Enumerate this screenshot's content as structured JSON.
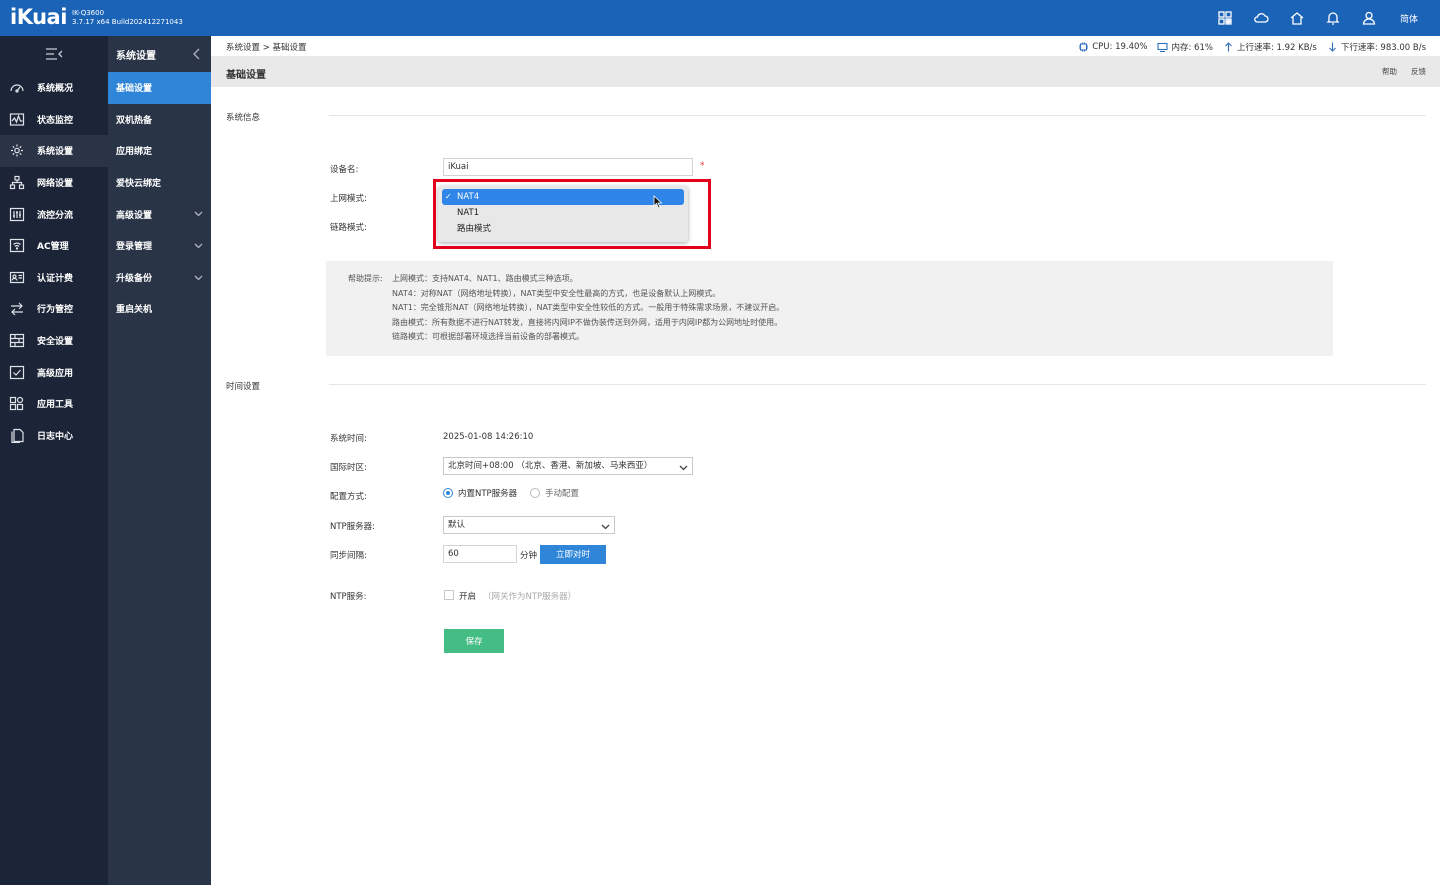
{
  "topbar": {
    "logo": "iKuai",
    "model": "IK-Q3600",
    "version": "3.7.17 x64 Build202412271043",
    "icons": [
      "grid-icon",
      "cloud-icon",
      "home-icon",
      "bell-icon",
      "user-icon"
    ],
    "lang": "简体"
  },
  "sidebar": {
    "items": [
      {
        "label": "系统概况",
        "icon": "dashboard-icon"
      },
      {
        "label": "状态监控",
        "icon": "monitor-icon"
      },
      {
        "label": "系统设置",
        "icon": "gear-icon",
        "active": true
      },
      {
        "label": "网络设置",
        "icon": "network-icon"
      },
      {
        "label": "流控分流",
        "icon": "sliders-icon"
      },
      {
        "label": "AC管理",
        "icon": "wifi-icon"
      },
      {
        "label": "认证计费",
        "icon": "id-card-icon"
      },
      {
        "label": "行为管控",
        "icon": "arrows-icon"
      },
      {
        "label": "安全设置",
        "icon": "firewall-icon"
      },
      {
        "label": "高级应用",
        "icon": "check-icon"
      },
      {
        "label": "应用工具",
        "icon": "apps-icon"
      },
      {
        "label": "日志中心",
        "icon": "log-icon"
      }
    ]
  },
  "subnav": {
    "title": "系统设置",
    "items": [
      {
        "label": "基础设置",
        "active": true
      },
      {
        "label": "双机热备"
      },
      {
        "label": "应用绑定"
      },
      {
        "label": "爱快云绑定"
      },
      {
        "label": "高级设置",
        "expand": true
      },
      {
        "label": "登录管理",
        "expand": true
      },
      {
        "label": "升级备份",
        "expand": true
      },
      {
        "label": "重启关机"
      }
    ]
  },
  "header": {
    "breadcrumb": "系统设置 > 基础设置",
    "cpu": "CPU: 19.40%",
    "mem": "内存: 61%",
    "up": "上行速率: 1.92 KB/s",
    "down": "下行速率: 983.00 B/s",
    "page_title": "基础设置",
    "help": "帮助",
    "feedback": "反馈"
  },
  "sysinfo": {
    "section": "系统信息",
    "device_label": "设备名:",
    "device_value": "iKuai",
    "required_mark": "*",
    "mode_label": "上网模式:",
    "link_label": "链路模式:",
    "dropdown_options": [
      "NAT4",
      "NAT1",
      "路由模式"
    ],
    "dropdown_selected": "NAT4",
    "check_mark": "✓"
  },
  "help": {
    "lead": "帮助提示:",
    "lines": [
      "上网模式：支持NAT4、NAT1、路由模式三种选项。",
      "NAT4：对称NAT（网络地址转换），NAT类型中安全性最高的方式，也是设备默认上网模式。",
      "NAT1：完全锥形NAT（网络地址转换），NAT类型中安全性较低的方式。一般用于特殊需求场景，不建议开启。",
      "路由模式：所有数据不进行NAT转发，直接将内网IP不做伪装传送到外网，适用于内网IP都为公网地址时使用。",
      "链路模式：可根据部署环境选择当前设备的部署模式。"
    ]
  },
  "time": {
    "section": "时间设置",
    "systime_label": "系统时间:",
    "systime_value": "2025-01-08 14:26:10",
    "tz_label": "国际时区:",
    "tz_value": "北京时间+08:00 （北京、香港、新加坡、马来西亚）",
    "cfg_label": "配置方式:",
    "cfg_builtin": "内置NTP服务器",
    "cfg_manual": "手动配置",
    "ntp_server_label": "NTP服务器:",
    "ntp_server_value": "默认",
    "sync_label": "同步间隔:",
    "sync_value": "60",
    "sync_unit": "分钟",
    "sync_now": "立即对时",
    "ntp_service_label": "NTP服务:",
    "ntp_enable": "开启",
    "ntp_hint": "（网关作为NTP服务器）",
    "save": "保存"
  }
}
